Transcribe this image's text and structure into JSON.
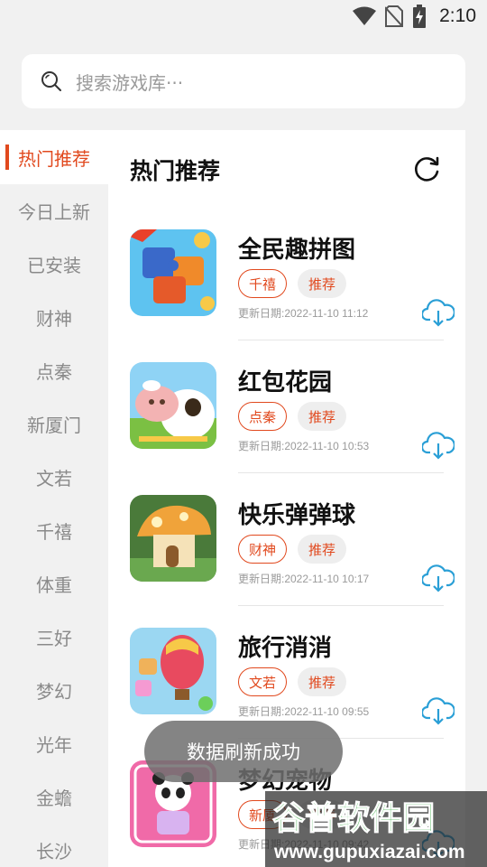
{
  "status_bar": {
    "time": "2:10"
  },
  "search": {
    "placeholder": "搜索游戏库···"
  },
  "sidebar": {
    "items": [
      {
        "label": "热门推荐",
        "active": true
      },
      {
        "label": "今日上新"
      },
      {
        "label": "已安装"
      },
      {
        "label": "财神"
      },
      {
        "label": "点秦"
      },
      {
        "label": "新厦门"
      },
      {
        "label": "文若"
      },
      {
        "label": "千禧"
      },
      {
        "label": "体重"
      },
      {
        "label": "三好"
      },
      {
        "label": "梦幻"
      },
      {
        "label": "光年"
      },
      {
        "label": "金蟾"
      },
      {
        "label": "长沙"
      }
    ]
  },
  "main": {
    "title": "热门推荐",
    "games": [
      {
        "name": "全民趣拼图",
        "tag": "千禧",
        "tag2": "推荐",
        "date": "更新日期:2022-11-10 11:12"
      },
      {
        "name": "红包花园",
        "tag": "点秦",
        "tag2": "推荐",
        "date": "更新日期:2022-11-10 10:53"
      },
      {
        "name": "快乐弹弹球",
        "tag": "财神",
        "tag2": "推荐",
        "date": "更新日期:2022-11-10 10:17"
      },
      {
        "name": "旅行消消",
        "tag": "文若",
        "tag2": "推荐",
        "date": "更新日期:2022-11-10 09:55"
      },
      {
        "name": "梦幻宠物",
        "tag": "新厦",
        "tag2": "推荐",
        "date": "更新日期:2022-11-10 09:42"
      }
    ]
  },
  "toast": {
    "message": "数据刷新成功"
  },
  "watermark": {
    "title": "谷普软件园",
    "url": "www.gupuxiazai.com"
  },
  "colors": {
    "accent": "#e1491e",
    "download": "#2a9fd6",
    "background": "#f1f1f1"
  }
}
